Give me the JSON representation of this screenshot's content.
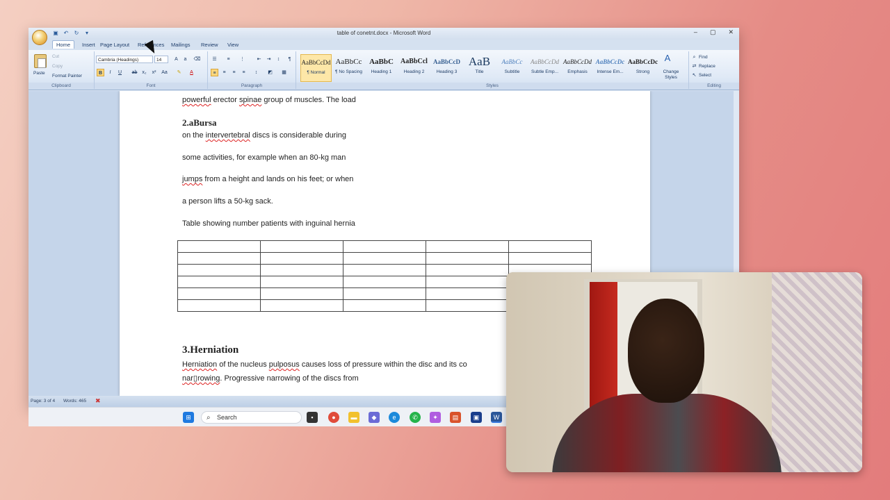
{
  "window": {
    "title": "table of conetnt.docx - Microsoft Word",
    "controls": [
      "–",
      "▢",
      "✕"
    ]
  },
  "tabs": [
    "Home",
    "Insert",
    "Page Layout",
    "References",
    "Mailings",
    "Review",
    "View"
  ],
  "ribbon": {
    "clipboard": {
      "label": "Clipboard",
      "paste": "Paste",
      "cut": "Cut",
      "copy": "Copy",
      "format_painter": "Format Painter"
    },
    "font": {
      "label": "Font",
      "family": "Cambria (Headings)",
      "size": "14"
    },
    "paragraph": {
      "label": "Paragraph"
    },
    "styles": {
      "label": "Styles",
      "items": [
        {
          "sample": "AaBbCcDd",
          "name": "¶ Normal"
        },
        {
          "sample": "AaBbCc",
          "name": "¶ No Spacing"
        },
        {
          "sample": "AaBbC",
          "name": "Heading 1"
        },
        {
          "sample": "AaBbCcl",
          "name": "Heading 2"
        },
        {
          "sample": "AaBbCcD",
          "name": "Heading 3"
        },
        {
          "sample": "AaB",
          "name": "Title"
        },
        {
          "sample": "AaBbCc",
          "name": "Subtitle"
        },
        {
          "sample": "AaBbCcDd",
          "name": "Subtle Emp..."
        },
        {
          "sample": "AaBbCcDd",
          "name": "Emphasis"
        },
        {
          "sample": "AaBbCcDc",
          "name": "Intense Em..."
        },
        {
          "sample": "AaBbCcDc",
          "name": "Strong"
        }
      ],
      "change_styles": "Change Styles"
    },
    "editing": {
      "label": "Editing",
      "find": "Find",
      "replace": "Replace",
      "select": "Select"
    }
  },
  "document": {
    "line1": {
      "pre": "",
      "u1": "powerful",
      "mid1": " erector ",
      "u2": "spinae",
      "post": " group of muscles. The load"
    },
    "heading_2a": "2.aBursa",
    "line2": {
      "pre": "on the ",
      "u": "intervertebral",
      "post": " discs is considerable during"
    },
    "line3": "some activities, for example when an 80-kg man",
    "line4": {
      "u": "jumps",
      "post": " from a height and lands on his feet; or when"
    },
    "line5": "a person lifts a 50-kg sack.",
    "caption": "Table showing number patients with inguinal hernia",
    "table": {
      "rows": 6,
      "cols": 5
    },
    "heading_3": "3.Herniation",
    "line6": {
      "u1": "Herniation",
      "mid1": " of the nucleus ",
      "u2": "pulposus",
      "post": " causes loss of pressure within the disc and its co"
    },
    "line7": {
      "u": "nar▯rowing",
      "post": ". Progressive narrowing of the discs from"
    }
  },
  "statusbar": {
    "page": "Page: 3 of 4",
    "words": "Words: 465"
  },
  "taskbar": {
    "search": "Search"
  }
}
